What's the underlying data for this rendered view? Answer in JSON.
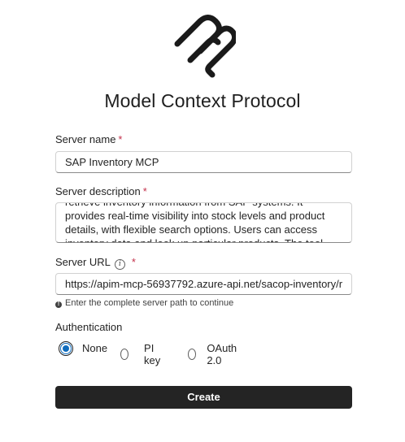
{
  "title": "Model Context Protocol",
  "form": {
    "server_name": {
      "label": "Server name",
      "required_mark": "*",
      "value": "SAP Inventory MCP"
    },
    "server_description": {
      "label": "Server description",
      "required_mark": "*",
      "lines": [
        "retrieve inventory information from SAP systems. It",
        "provides real-time visibility into stock levels and product",
        "details, with flexible search options. Users can access",
        "inventory data and look up particular products. The tool"
      ]
    },
    "server_url": {
      "label": "Server URL",
      "info_icon": "info-icon",
      "required_mark": "*",
      "value": "https://apim-mcp-56937792.azure-api.net/sacop-inventory/r",
      "hint": "Enter the complete server path to continue",
      "hint_icon": "info-filled-icon"
    },
    "authentication": {
      "label": "Authentication",
      "options": [
        "None",
        "PI key",
        "OAuth 2.0"
      ],
      "selected": "None"
    },
    "submit_label": "Create"
  },
  "colors": {
    "accent": "#0f6cbd",
    "required": "#c4314b",
    "button_bg": "#242424",
    "button_text": "#ffffff"
  }
}
